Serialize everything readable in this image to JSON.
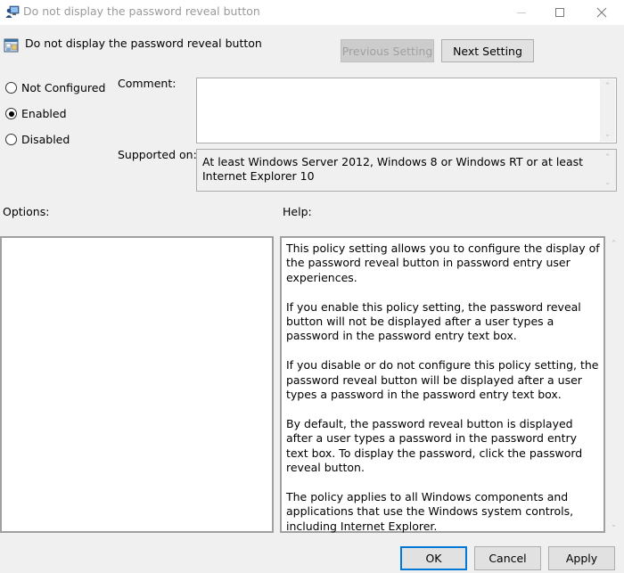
{
  "window": {
    "title": "Do not display the password reveal button",
    "app_icon": "group-policy-editor-icon",
    "controls": {
      "minimize": "minimize-icon",
      "maximize": "maximize-icon",
      "close": "close-icon"
    }
  },
  "header": {
    "policy_icon": "policy-setting-icon",
    "policy_title": "Do not display the password reveal button",
    "previous_setting_label": "Previous Setting",
    "previous_setting_enabled": false,
    "next_setting_label": "Next Setting"
  },
  "state": {
    "options": [
      {
        "label": "Not Configured",
        "checked": false
      },
      {
        "label": "Enabled",
        "checked": true
      },
      {
        "label": "Disabled",
        "checked": false
      }
    ]
  },
  "comment": {
    "label": "Comment:",
    "value": ""
  },
  "supported": {
    "label": "Supported on:",
    "value": "At least Windows Server 2012, Windows 8 or Windows RT or at least Internet Explorer 10"
  },
  "options_panel": {
    "label": "Options:"
  },
  "help_panel": {
    "label": "Help:",
    "paragraphs": [
      "This policy setting allows you to configure the display of the password reveal button in password entry user experiences.",
      "If you enable this policy setting, the password reveal button will not be displayed after a user types a password in the password entry text box.",
      "If you disable or do not configure this policy setting, the password reveal button will be displayed after a user types a password in the password entry text box.",
      "By default, the password reveal button is displayed after a user types a password in the password entry text box. To display the password, click the password reveal button.",
      "The policy applies to all Windows components and applications that use the Windows system controls, including Internet Explorer."
    ]
  },
  "footer": {
    "ok_label": "OK",
    "cancel_label": "Cancel",
    "apply_label": "Apply"
  },
  "colors": {
    "window_bg": "#f0f0f0",
    "default_button_border": "#0078d7",
    "disabled_text": "#a0a0a0"
  }
}
